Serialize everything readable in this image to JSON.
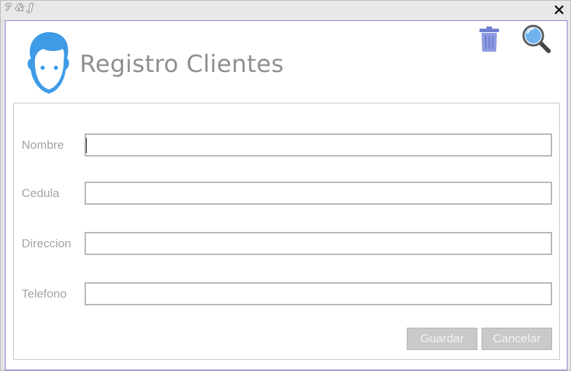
{
  "window": {
    "app_title": "7 & J",
    "close_symbol": "✕"
  },
  "header": {
    "title": "Registro Clientes",
    "avatar_icon": "user-avatar-icon",
    "trash_icon": "trash-icon",
    "search_icon": "search-icon"
  },
  "form": {
    "fields": [
      {
        "label": "Nombre",
        "value": "",
        "placeholder": ""
      },
      {
        "label": "Cedula",
        "value": "",
        "placeholder": ""
      },
      {
        "label": "Direccion",
        "value": "",
        "placeholder": ""
      },
      {
        "label": "Telefono",
        "value": "",
        "placeholder": ""
      }
    ],
    "save_label": "Guardar",
    "cancel_label": "Cancelar"
  },
  "colors": {
    "accent_blue": "#3f9be6",
    "trash_blue": "#6f7fd0",
    "frame_border": "#7f7fd6",
    "label_gray": "#a3a3a3",
    "button_gray": "#c9c9c9"
  }
}
